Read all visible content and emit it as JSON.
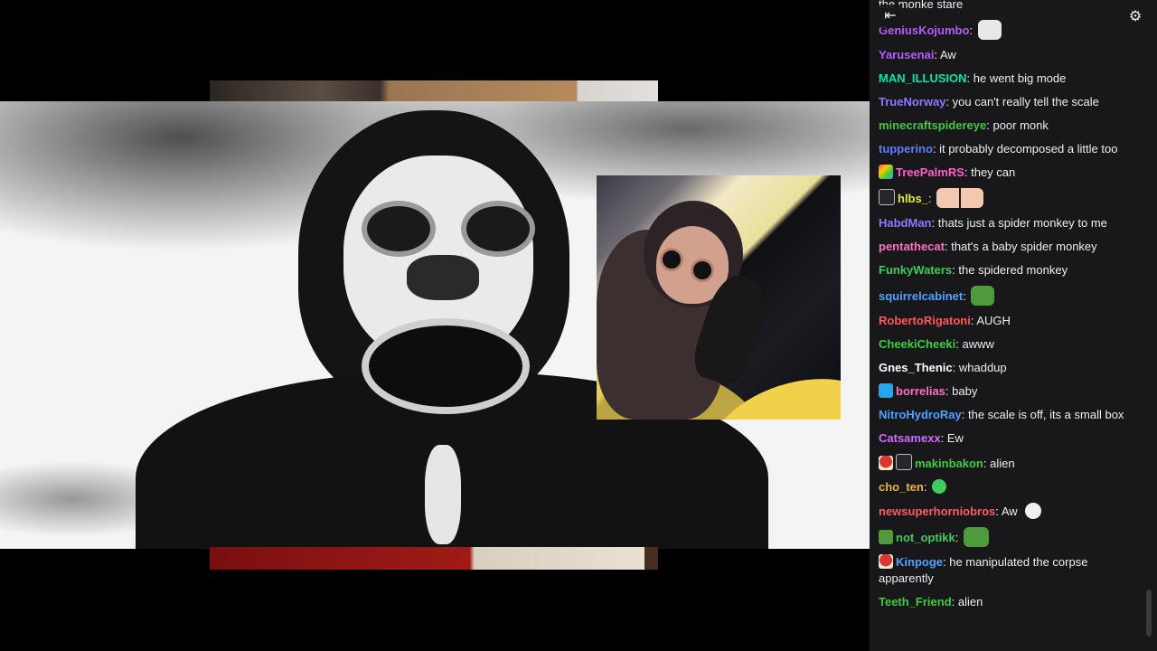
{
  "chat": {
    "collapse_icon": "collapse-arrow-icon",
    "settings_icon": "gear-icon",
    "top_partial": "the monke stare",
    "messages": [
      {
        "user": "GeniusKojumbo",
        "color": "#b65bff",
        "text": "",
        "emote": "emote-sheep"
      },
      {
        "user": "Yarusenai",
        "color": "#b65bff",
        "text": "Aw"
      },
      {
        "user": "MAN_ILLUSION",
        "color": "#00e6a8",
        "text": "he went big mode"
      },
      {
        "user": "TrueNorway",
        "color": "#8b7bff",
        "text": "you can't really tell the scale"
      },
      {
        "user": "minecraftspidereye",
        "color": "#3ec93e",
        "text": "poor monk"
      },
      {
        "user": "tupperino",
        "color": "#5c7cff",
        "text": "it probably decomposed a little too"
      },
      {
        "user": "TreePalmRS",
        "color": "#ff5fc8",
        "text": "they can",
        "badge": "badge-colorful"
      },
      {
        "user": "hlbs_",
        "color": "#e8e83c",
        "text": "",
        "badge": "badge-slash",
        "emote": "emote-faces"
      },
      {
        "user": "HabdMan",
        "color": "#8a7aff",
        "text": "thats just a spider monkey to me"
      },
      {
        "user": "pentathecat",
        "color": "#ff6fc4",
        "text": "that's a baby spider monkey"
      },
      {
        "user": "FunkyWaters",
        "color": "#3ecc5c",
        "text": "the spidered monkey"
      },
      {
        "user": "squirrelcabinet",
        "color": "#4ea2ff",
        "text": "",
        "emote": "emote-pepe-small"
      },
      {
        "user": "RobertoRigatoni",
        "color": "#ff5757",
        "text": "AUGH"
      },
      {
        "user": "CheekiCheeki",
        "color": "#3ecc3e",
        "text": "awww"
      },
      {
        "user": "Gnes_Thenic",
        "color": "#ffffff",
        "text": "whaddup"
      },
      {
        "user": "borrelias",
        "color": "#ff6fc4",
        "text": "baby",
        "badge": "badge-crown"
      },
      {
        "user": "NitroHydroRay",
        "color": "#4ea2ff",
        "text": "the scale is off, its a small box"
      },
      {
        "user": "Catsamexx",
        "color": "#d06cff",
        "text": "Ew"
      },
      {
        "user": "makinbakon",
        "color": "#3ecc3e",
        "text": "alien",
        "badge": "badge-mushroom",
        "badge2": "badge-slash"
      },
      {
        "user": "cho_ten",
        "color": "#f0b03c",
        "text": "",
        "emote": "emote-alien"
      },
      {
        "user": "newsuperhorniobros",
        "color": "#ff5a6a",
        "text": "Aw",
        "emote": "emote-skull"
      },
      {
        "user": "not_optikk",
        "color": "#3ecc5c",
        "text": "",
        "badge": "badge-pepe",
        "emote": "emote-pepe"
      },
      {
        "user": "Kinpoge",
        "color": "#4ea2ff",
        "text": "he manipulated the corpse apparently",
        "badge": "badge-mushroom"
      },
      {
        "user": "Teeth_Friend",
        "color": "#3ecc3e",
        "text": "alien"
      }
    ]
  },
  "video": {
    "main_image": "black-and-white spider monkey photo",
    "inset_image": "baby spider monkey photo"
  }
}
